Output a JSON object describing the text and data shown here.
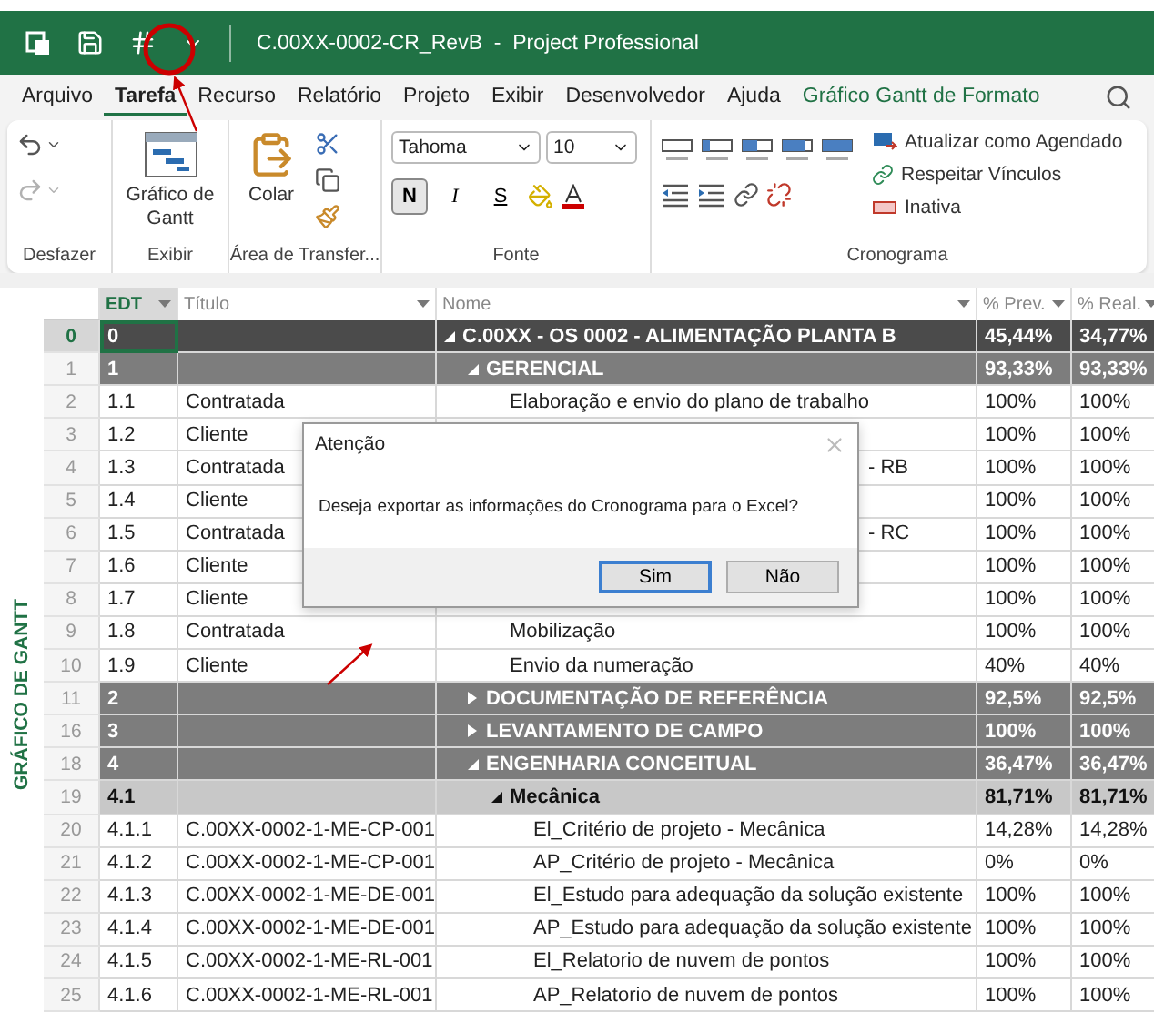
{
  "title_bar": {
    "title": "C.00XX-0002-CR_RevB  -  Project Professional"
  },
  "menu_tabs": [
    {
      "label": "Arquivo",
      "selected": false,
      "kind": "tab"
    },
    {
      "label": "Tarefa",
      "selected": true,
      "kind": "tab"
    },
    {
      "label": "Recurso",
      "selected": false,
      "kind": "tab"
    },
    {
      "label": "Relatório",
      "selected": false,
      "kind": "tab"
    },
    {
      "label": "Projeto",
      "selected": false,
      "kind": "tab"
    },
    {
      "label": "Exibir",
      "selected": false,
      "kind": "tab"
    },
    {
      "label": "Desenvolvedor",
      "selected": false,
      "kind": "tab"
    },
    {
      "label": "Ajuda",
      "selected": false,
      "kind": "tab"
    },
    {
      "label": "Gráfico Gantt de Formato",
      "selected": false,
      "kind": "contextual"
    }
  ],
  "ribbon": {
    "undo_group": {
      "label": "Desfazer"
    },
    "view_group": {
      "label": "Exibir",
      "gantt_button": "Gráfico de Gantt"
    },
    "clipboard_group": {
      "label": "Área de Transfer...",
      "paste_button": "Colar"
    },
    "font_group": {
      "label": "Fonte",
      "font_name": "Tahoma",
      "font_size": "10",
      "styles": [
        {
          "label": "N",
          "on": true,
          "kind": "bold"
        },
        {
          "label": "I",
          "on": false,
          "kind": "italic"
        },
        {
          "label": "S",
          "on": false,
          "kind": "underline"
        }
      ]
    },
    "schedule_group": {
      "label": "Cronograma",
      "commands": [
        {
          "label": "Atualizar como Agendado",
          "kind": "update"
        },
        {
          "label": "Respeitar Vínculos",
          "kind": "links"
        },
        {
          "label": "Inativa",
          "kind": "inactive"
        }
      ]
    }
  },
  "side_label": "GRÁFICO DE GANTT",
  "table": {
    "columns": [
      {
        "label": "EDT",
        "selected": true
      },
      {
        "label": "Título",
        "selected": false
      },
      {
        "label": "Nome",
        "selected": false
      },
      {
        "label": "% Prev.",
        "selected": false
      },
      {
        "label": "% Real.",
        "selected": false
      }
    ],
    "rows": [
      {
        "id": "0",
        "edt": "0",
        "name": "C.00XX - OS 0002 - ALIMENTAÇÃO PLANTA B",
        "prev": "45,44%",
        "real": "34,77%",
        "kind": "project",
        "expanded": true,
        "selected": true,
        "children": [
          {
            "id": "1",
            "edt": "1",
            "name": "GERENCIAL",
            "prev": "93,33%",
            "real": "93,33%",
            "kind": "summary",
            "expanded": true,
            "selected": false,
            "children": [
              {
                "id": "2",
                "edt": "1.1",
                "title": "Contratada",
                "name": "Elaboração e envio do plano de trabalho",
                "prev": "100%",
                "real": "100%",
                "kind": "task",
                "selected": false
              },
              {
                "id": "3",
                "edt": "1.2",
                "title": "Cliente",
                "prev": "100%",
                "real": "100%",
                "kind": "task",
                "selected": false
              },
              {
                "id": "4",
                "edt": "1.3",
                "title": "Contratada",
                "name": "- RB",
                "covered": true,
                "prev": "100%",
                "real": "100%",
                "kind": "task",
                "selected": false
              },
              {
                "id": "5",
                "edt": "1.4",
                "title": "Cliente",
                "prev": "100%",
                "real": "100%",
                "kind": "task",
                "selected": false
              },
              {
                "id": "6",
                "edt": "1.5",
                "title": "Contratada",
                "name": "- RC",
                "covered": true,
                "prev": "100%",
                "real": "100%",
                "kind": "task",
                "selected": false
              },
              {
                "id": "7",
                "edt": "1.6",
                "title": "Cliente",
                "prev": "100%",
                "real": "100%",
                "kind": "task",
                "selected": false
              },
              {
                "id": "8",
                "edt": "1.7",
                "title": "Cliente",
                "prev": "100%",
                "real": "100%",
                "kind": "task",
                "selected": false
              },
              {
                "id": "9",
                "edt": "1.8",
                "title": "Contratada",
                "name": "Mobilização",
                "prev": "100%",
                "real": "100%",
                "kind": "task",
                "selected": false
              },
              {
                "id": "10",
                "edt": "1.9",
                "title": "Cliente",
                "name": "Envio da numeração",
                "prev": "40%",
                "real": "40%",
                "kind": "task",
                "selected": false
              }
            ]
          },
          {
            "id": "11",
            "edt": "2",
            "name": "DOCUMENTAÇÃO DE REFERÊNCIA",
            "prev": "92,5%",
            "real": "92,5%",
            "kind": "summary",
            "expanded": false,
            "selected": false
          },
          {
            "id": "16",
            "edt": "3",
            "name": "LEVANTAMENTO DE CAMPO",
            "prev": "100%",
            "real": "100%",
            "kind": "summary",
            "expanded": false,
            "selected": false
          },
          {
            "id": "18",
            "edt": "4",
            "name": "ENGENHARIA CONCEITUAL",
            "prev": "36,47%",
            "real": "36,47%",
            "kind": "summary",
            "expanded": true,
            "selected": false,
            "children": [
              {
                "id": "19",
                "edt": "4.1",
                "name": "Mecânica",
                "prev": "81,71%",
                "real": "81,71%",
                "kind": "group",
                "expanded": true,
                "selected": false,
                "children": [
                  {
                    "id": "20",
                    "edt": "4.1.1",
                    "title": "C.00XX-0002-1-ME-CP-001",
                    "name": "El_Critério de projeto - Mecânica",
                    "prev": "14,28%",
                    "real": "14,28%",
                    "kind": "task",
                    "selected": false
                  },
                  {
                    "id": "21",
                    "edt": "4.1.2",
                    "title": "C.00XX-0002-1-ME-CP-001",
                    "name": "AP_Critério de projeto - Mecânica",
                    "prev": "0%",
                    "real": "0%",
                    "kind": "task",
                    "selected": false
                  },
                  {
                    "id": "22",
                    "edt": "4.1.3",
                    "title": "C.00XX-0002-1-ME-DE-001",
                    "name": "El_Estudo para adequação da solução existente",
                    "prev": "100%",
                    "real": "100%",
                    "kind": "task",
                    "selected": false
                  },
                  {
                    "id": "23",
                    "edt": "4.1.4",
                    "title": "C.00XX-0002-1-ME-DE-001",
                    "name": "AP_Estudo para adequação da solução existente",
                    "prev": "100%",
                    "real": "100%",
                    "kind": "task",
                    "selected": false
                  },
                  {
                    "id": "24",
                    "edt": "4.1.5",
                    "title": "C.00XX-0002-1-ME-RL-001",
                    "name": "El_Relatorio de nuvem de pontos",
                    "prev": "100%",
                    "real": "100%",
                    "kind": "task",
                    "selected": false
                  },
                  {
                    "id": "25",
                    "edt": "4.1.6",
                    "title": "C.00XX-0002-1-ME-RL-001",
                    "name": "AP_Relatorio de nuvem de pontos",
                    "prev": "100%",
                    "real": "100%",
                    "kind": "task",
                    "selected": false
                  }
                ]
              }
            ]
          }
        ]
      }
    ]
  },
  "dialog": {
    "title": "Atenção",
    "message": "Deseja exportar as informações do Cronograma para o Excel?",
    "buttons": [
      {
        "label": "Sim",
        "selected": true
      },
      {
        "label": "Não",
        "selected": false
      }
    ]
  }
}
